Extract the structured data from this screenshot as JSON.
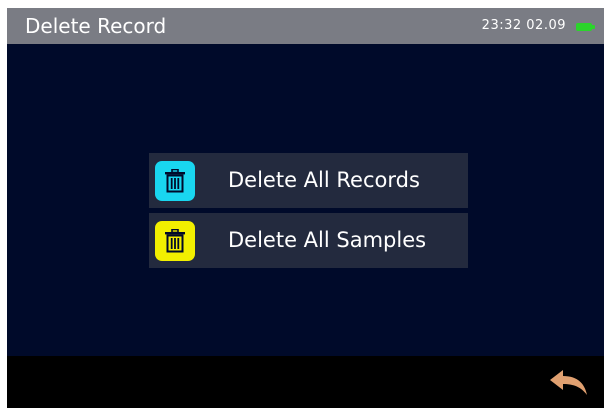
{
  "header": {
    "title": "Delete Record",
    "time": "23:32",
    "date": "02.09",
    "battery_icon": "battery-icon",
    "battery_color": "#2bd42b"
  },
  "menu": {
    "items": [
      {
        "label": "Delete All Records",
        "icon": "trash-icon",
        "icon_color": "#19d6f0"
      },
      {
        "label": "Delete All Samples",
        "icon": "trash-icon",
        "icon_color": "#f2ef00"
      }
    ]
  },
  "footer": {
    "back_icon": "back-arrow-icon",
    "back_color": "#e0a070"
  },
  "colors": {
    "background": "#000a2a",
    "header": "#7a7c84",
    "menu_item": "#232a3e"
  }
}
